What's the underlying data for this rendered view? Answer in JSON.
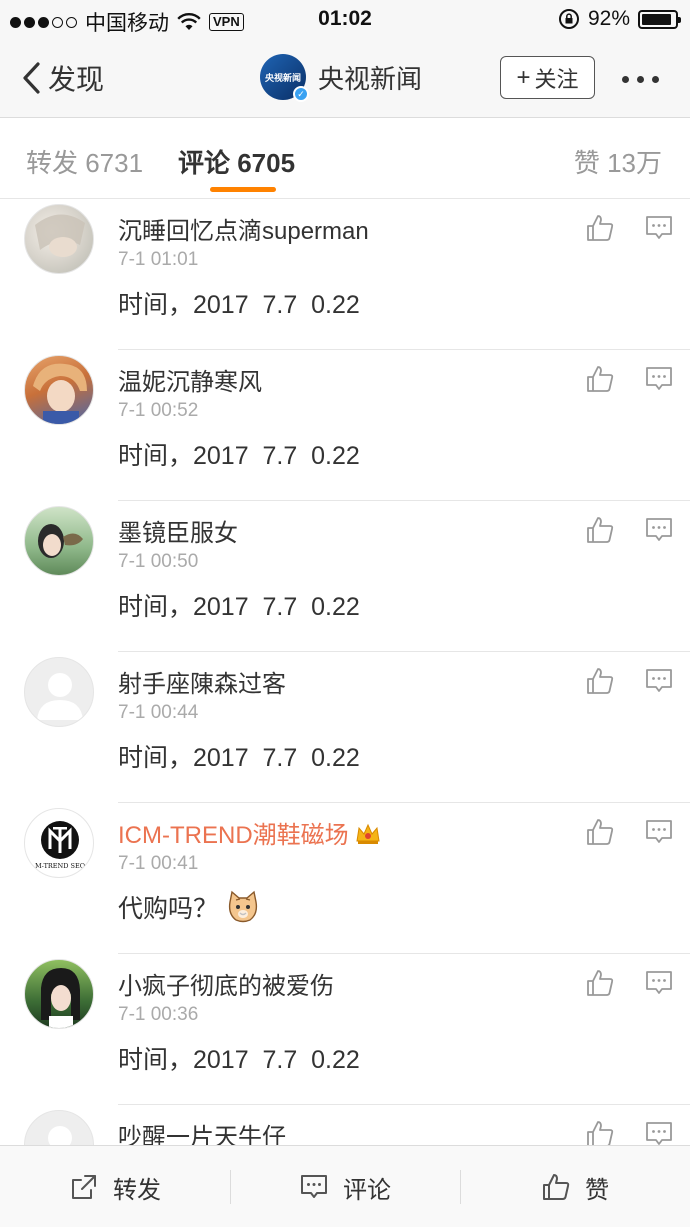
{
  "status_bar": {
    "carrier": "中国移动",
    "vpn": "VPN",
    "time": "01:02",
    "battery": "92%",
    "battery_level": 0.92
  },
  "nav": {
    "back_label": "发现",
    "title": "央视新闻",
    "logo_text": "央视新闻",
    "follow_label": "关注"
  },
  "tabs": {
    "repost": "转发 6731",
    "comment": "评论 6705",
    "like": "赞 13万"
  },
  "comments": [
    {
      "name": "沉睡回忆点滴superman",
      "time": "7-1 01:01",
      "text": "时间，2017  7.7  0.22"
    },
    {
      "name": "温妮沉静寒风",
      "time": "7-1 00:52",
      "text": "时间，2017  7.7  0.22"
    },
    {
      "name": "墨镜臣服女",
      "time": "7-1 00:50",
      "text": "时间，2017  7.7  0.22"
    },
    {
      "name": "射手座陳森过客",
      "time": "7-1 00:44",
      "text": "时间，2017  7.7  0.22"
    },
    {
      "name": "ICM-TREND潮鞋磁场",
      "time": "7-1 00:41",
      "text": "代购吗？",
      "avatar_text": "M-TREND SEO"
    },
    {
      "name": "小疯子彻底的被爱伤",
      "time": "7-1 00:36",
      "text": "时间，2017  7.7  0.22"
    },
    {
      "name": "吵醒一片天牛仔",
      "time": "",
      "text": ""
    }
  ],
  "bottom_bar": {
    "repost": "转发",
    "comment": "评论",
    "like": "赞"
  },
  "colors": {
    "accent": "#ff8200",
    "vip_name": "#eb7350"
  }
}
